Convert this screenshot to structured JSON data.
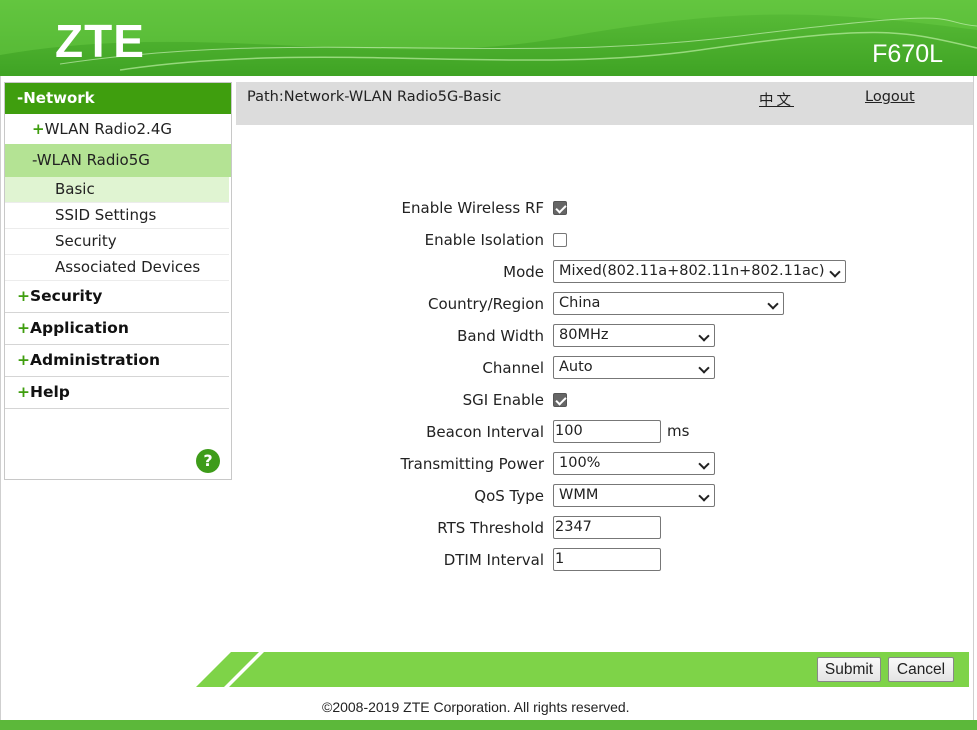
{
  "header": {
    "brand": "ZTE",
    "model": "F670L"
  },
  "sidebar": {
    "network_label": "-Network",
    "wlan24_label": "WLAN Radio2.4G",
    "wlan5_label": "-WLAN Radio5G",
    "leaves": [
      "Basic",
      "SSID Settings",
      "Security",
      "Associated Devices"
    ],
    "main_items": [
      "Security",
      "Application",
      "Administration",
      "Help"
    ],
    "help_glyph": "?"
  },
  "pathbar": {
    "path": "Path:Network-WLAN Radio5G-Basic",
    "lang": "中文",
    "logout": "Logout"
  },
  "form": {
    "enable_wireless_rf": {
      "label": "Enable Wireless RF",
      "checked": true
    },
    "enable_isolation": {
      "label": "Enable Isolation",
      "checked": false
    },
    "mode": {
      "label": "Mode",
      "value": "Mixed(802.11a+802.11n+802.11ac)"
    },
    "country": {
      "label": "Country/Region",
      "value": "China"
    },
    "band_width": {
      "label": "Band Width",
      "value": "80MHz"
    },
    "channel": {
      "label": "Channel",
      "value": "Auto"
    },
    "sgi_enable": {
      "label": "SGI Enable",
      "checked": true
    },
    "beacon_interval": {
      "label": "Beacon Interval",
      "value": "100",
      "unit": "ms"
    },
    "transmitting_power": {
      "label": "Transmitting Power",
      "value": "100%"
    },
    "qos_type": {
      "label": "QoS Type",
      "value": "WMM"
    },
    "rts_threshold": {
      "label": "RTS Threshold",
      "value": "2347"
    },
    "dtim_interval": {
      "label": "DTIM Interval",
      "value": "1"
    }
  },
  "footer": {
    "submit": "Submit",
    "cancel": "Cancel",
    "copyright": "©2008-2019 ZTE Corporation. All rights reserved."
  },
  "colors": {
    "brand_green": "#3f9e0e",
    "header_green": "#4cb12c",
    "bar_green": "#7ed348"
  }
}
